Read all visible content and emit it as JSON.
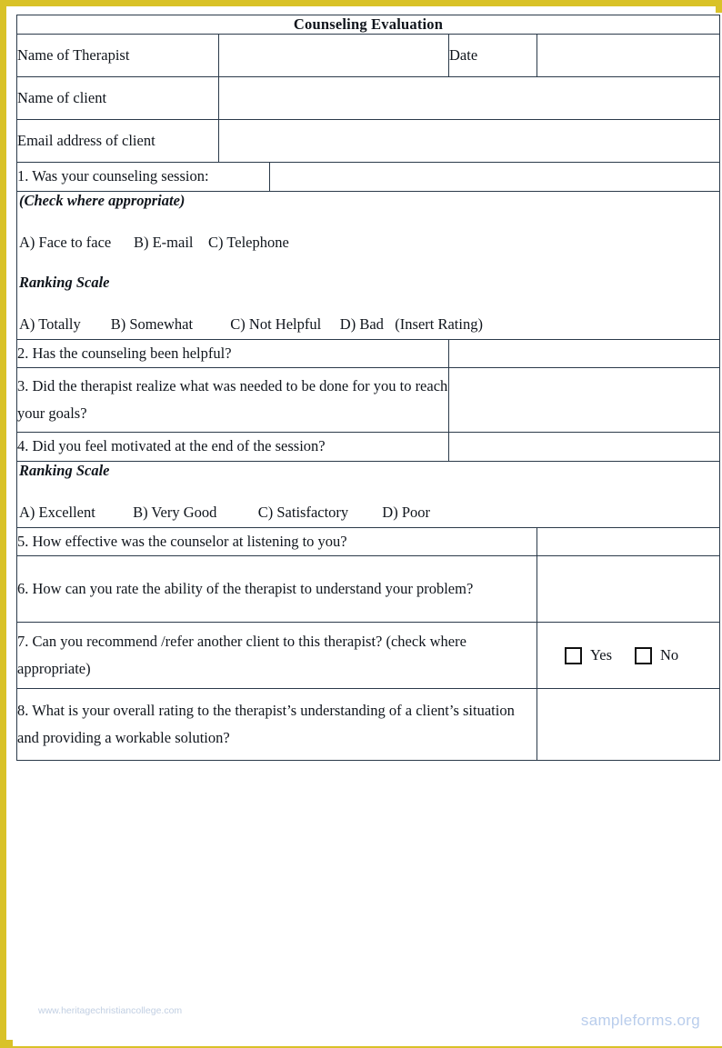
{
  "document": {
    "title": "Counseling Evaluation"
  },
  "fields": {
    "therapist_label": "Name of Therapist",
    "date_label": "Date",
    "client_label": "Name of client",
    "email_label": "Email address of client",
    "therapist_value": "",
    "date_value": "",
    "client_value": "",
    "email_value": ""
  },
  "questions": [
    {
      "number": "1",
      "text": "1. Was your counseling session:",
      "answer": ""
    },
    {
      "number": "2",
      "text": "2. Has the counseling been helpful?",
      "answer": ""
    },
    {
      "number": "3",
      "text": "3. Did the therapist realize what was needed to be done for you to reach your goals?",
      "answer": ""
    },
    {
      "number": "4",
      "text": "4. Did you feel motivated at the end of the session?",
      "answer": ""
    },
    {
      "number": "5",
      "text": "5. How effective was the counselor at listening to you?",
      "answer": ""
    },
    {
      "number": "6",
      "text": "6. How can you rate the ability of the therapist to understand your problem?",
      "answer": ""
    },
    {
      "number": "7",
      "text": "7. Can you recommend /refer another client to this therapist? (check where appropriate)",
      "answer": ""
    },
    {
      "number": "8",
      "text": "8. What is your overall rating to the therapist’s understanding of a client’s situation and providing a workable solution?",
      "answer": ""
    }
  ],
  "section_one": {
    "instruction": "(Check where appropriate)",
    "options": "A) Face to face      B) E-mail    C) Telephone",
    "ranking_heading": "Ranking Scale",
    "ranking_options": "A) Totally        B) Somewhat          C) Not Helpful     D) Bad   (Insert Rating)"
  },
  "section_two": {
    "ranking_heading": "Ranking Scale",
    "ranking_options": "A) Excellent          B) Very Good           C) Satisfactory         D) Poor"
  },
  "yes_no": {
    "yes_label": "Yes",
    "no_label": "No",
    "yes_checked": false,
    "no_checked": false
  },
  "watermarks": {
    "site": "sampleforms.org",
    "faint": "www.heritagechristiancollege.com"
  },
  "colors": {
    "frame": "#d9c228",
    "header_blue": "#a6bdde",
    "label_blue": "#cfdef4",
    "border": "#2b3a4a",
    "watermark": "#b9cdec"
  }
}
